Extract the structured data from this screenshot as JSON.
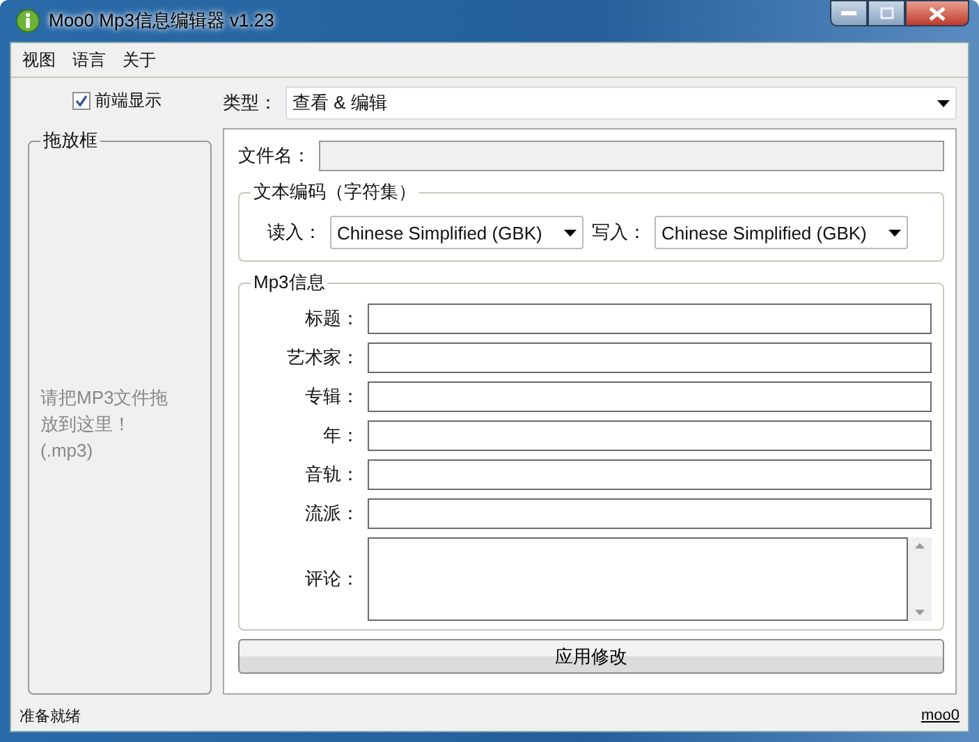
{
  "window": {
    "title": "Moo0 Mp3信息编辑器 v1.23"
  },
  "menu": [
    "视图",
    "语言",
    "关于"
  ],
  "topmost": {
    "label": "前端显示",
    "checked": true
  },
  "drop_box": {
    "title": "拖放框",
    "hint": "请把MP3文件拖放到这里！(.mp3)"
  },
  "type": {
    "label": "类型：",
    "value": "查看 & 编辑"
  },
  "filename": {
    "label": "文件名：",
    "disabled": true
  },
  "encoding": {
    "title": "文本编码（字符集）",
    "read_label": "读入：",
    "read_value": "Chinese Simplified (GBK)",
    "write_label": "写入：",
    "write_value": "Chinese Simplified (GBK)"
  },
  "mp3_info": {
    "title": "Mp3信息",
    "fields": [
      {
        "label": "标题：",
        "kind": "line"
      },
      {
        "label": "艺术家：",
        "kind": "line"
      },
      {
        "label": "专辑：",
        "kind": "line"
      },
      {
        "label": "年：",
        "kind": "line"
      },
      {
        "label": "音轨：",
        "kind": "line"
      },
      {
        "label": "流派：",
        "kind": "line"
      },
      {
        "label": "评论：",
        "kind": "multi"
      }
    ]
  },
  "apply_button": "应用修改",
  "status_bar": {
    "text": "准备就绪",
    "link": "moo0"
  }
}
